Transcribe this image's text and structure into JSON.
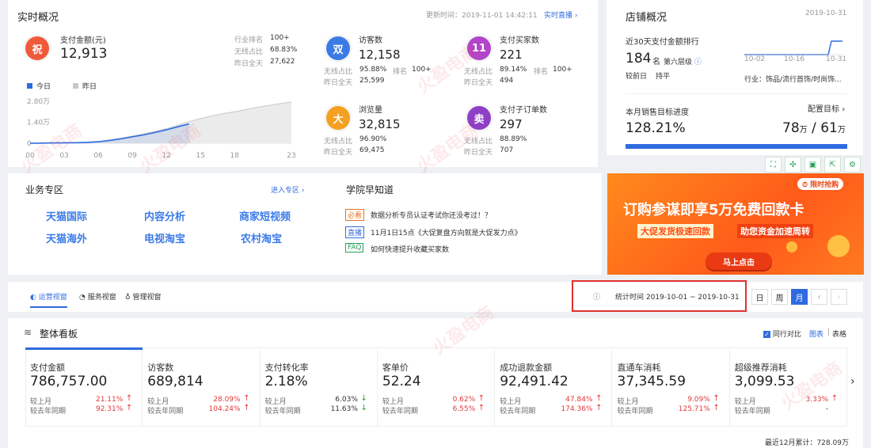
{
  "realtime": {
    "title": "实时概况",
    "update_label": "更新时间：2019-11-01 14:42:11",
    "live_link": "实时直播",
    "pay_amount": {
      "label": "支付金额(元)",
      "value": "12,913",
      "rank_label": "行业排名",
      "rank": "100+",
      "wireless_label": "无线占比",
      "wireless": "68.83%",
      "yday_label": "昨日全天",
      "yday": "27,622"
    },
    "legend_today": "今日",
    "legend_yday": "昨日",
    "chart_data": {
      "type": "area",
      "x_ticks": [
        "00",
        "03",
        "06",
        "09",
        "12",
        "15",
        "18",
        "23"
      ],
      "y_ticks": [
        "2.80万",
        "1.40万",
        "0"
      ],
      "ylim": [
        0,
        28000
      ],
      "series": [
        {
          "name": "今日",
          "x": [
            0,
            1,
            2,
            3,
            4,
            5,
            6,
            7,
            8,
            9,
            10,
            11,
            12,
            13,
            14
          ],
          "values": [
            0,
            120,
            220,
            300,
            380,
            550,
            1000,
            1900,
            3000,
            4300,
            5600,
            7200,
            9000,
            11000,
            12913
          ]
        },
        {
          "name": "昨日",
          "x": [
            0,
            1,
            2,
            3,
            4,
            5,
            6,
            7,
            8,
            9,
            10,
            11,
            12,
            13,
            14,
            15,
            16,
            17,
            18,
            19,
            20,
            21,
            22,
            23
          ],
          "values": [
            0,
            150,
            250,
            350,
            450,
            700,
            1200,
            2200,
            3300,
            4800,
            6300,
            8000,
            9800,
            12000,
            14500,
            16500,
            18300,
            19800,
            21000,
            22500,
            24000,
            25200,
            26400,
            27622
          ]
        }
      ]
    },
    "visitors": {
      "icon": "双",
      "label": "访客数",
      "value": "12,158",
      "wireless_label": "无线占比",
      "wireless": "95.88%",
      "rank_label": "排名",
      "rank": "100+",
      "yday_label": "昨日全天",
      "yday": "25,599"
    },
    "buyers": {
      "icon": "11",
      "label": "支付买家数",
      "value": "221",
      "wireless_label": "无线占比",
      "wireless": "89.14%",
      "rank_label": "排名",
      "rank": "100+",
      "yday_label": "昨日全天",
      "yday": "494"
    },
    "pageviews": {
      "icon": "大",
      "label": "浏览量",
      "value": "32,815",
      "wireless_label": "无线占比",
      "wireless": "96.90%",
      "yday_label": "昨日全天",
      "yday": "69,475"
    },
    "suborders": {
      "icon": "卖",
      "label": "支付子订单数",
      "value": "297",
      "wireless_label": "无线占比",
      "wireless": "88.89%",
      "yday_label": "昨日全天",
      "yday": "707"
    }
  },
  "shop": {
    "title": "店铺概况",
    "date": "2019-10-31",
    "rank_title": "近30天支付金额排行",
    "rank_value": "184",
    "rank_unit": "名",
    "rank_level": "第六层级",
    "prev_label": "较前日",
    "prev_value": "持平",
    "spark_labels": [
      "10-02",
      "10-16",
      "10-31"
    ],
    "industry": "行业：饰品/流行首饰/时尚饰...",
    "target_title": "本月销售目标进度",
    "config_link": "配置目标",
    "target_pct": "128.21%",
    "target_done": "78",
    "target_goal": "61",
    "wan": "万",
    "progress": 1.0
  },
  "banner": {
    "badge": "限时抢购",
    "headline": "订购参谋即享5万免费回款卡",
    "sub1": "大促发货极速回款",
    "sub2": "助您资金加速周转",
    "cta": "马上点击"
  },
  "business": {
    "title": "业务专区",
    "enter": "进入专区",
    "items": [
      "天猫国际",
      "内容分析",
      "商家短视频",
      "天猫海外",
      "电视淘宝",
      "农村淘宝"
    ]
  },
  "academy": {
    "title": "学院早知道",
    "items": [
      {
        "tag": "必看",
        "text": "数据分析专员认证考试你还没考过！？"
      },
      {
        "tag": "直播",
        "text": "11月1日15点《大促复盘方向就是大促发力点》"
      },
      {
        "tag": "FAQ",
        "text": "如何快速提升收藏买家数"
      }
    ]
  },
  "views": {
    "tabs": [
      "运营视窗",
      "服务视窗",
      "管理视窗"
    ],
    "stat_time": "统计时间 2019-10-01 ~ 2019-10-31",
    "periods": [
      "日",
      "周",
      "月"
    ]
  },
  "board": {
    "title": "整体看板",
    "compare": "同行对比",
    "chart": "图表",
    "table": "表格",
    "mom_label": "较上月",
    "yoy_label": "较去年同期",
    "metrics": [
      {
        "label": "支付金额",
        "value": "786,757.00",
        "mom": "21.11%",
        "mom_dir": "up",
        "yoy": "92.31%",
        "yoy_dir": "up"
      },
      {
        "label": "访客数",
        "value": "689,814",
        "mom": "28.09%",
        "mom_dir": "up",
        "yoy": "104.24%",
        "yoy_dir": "up"
      },
      {
        "label": "支付转化率",
        "value": "2.18%",
        "mom": "6.03%",
        "mom_dir": "down",
        "yoy": "11.63%",
        "yoy_dir": "down"
      },
      {
        "label": "客单价",
        "value": "52.24",
        "mom": "0.62%",
        "mom_dir": "up",
        "yoy": "6.55%",
        "yoy_dir": "up"
      },
      {
        "label": "成功退款金额",
        "value": "92,491.42",
        "mom": "47.84%",
        "mom_dir": "up",
        "yoy": "174.36%",
        "yoy_dir": "up"
      },
      {
        "label": "直通车消耗",
        "value": "37,345.59",
        "mom": "9.09%",
        "mom_dir": "up",
        "yoy": "125.71%",
        "yoy_dir": "up"
      },
      {
        "label": "超级推荐消耗",
        "value": "3,099.53",
        "mom": "3.33%",
        "mom_dir": "up",
        "yoy": "-",
        "yoy_dir": "none"
      }
    ],
    "footer": "最近12月累计：728.09万"
  },
  "colors": {
    "accent": "#2f6be0",
    "red": "#e03a3a",
    "green": "#2aa13b",
    "banner": "#ff6a1a"
  }
}
